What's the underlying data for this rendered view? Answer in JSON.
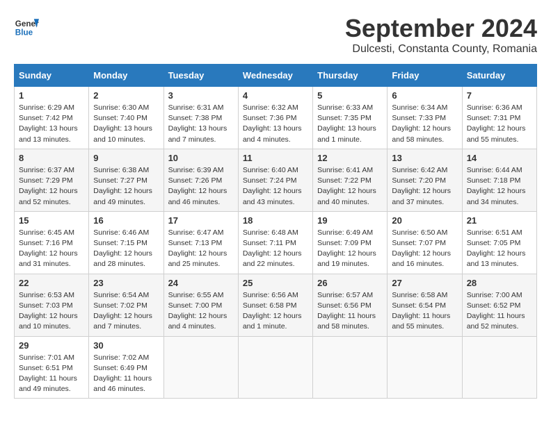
{
  "header": {
    "logo_line1": "General",
    "logo_line2": "Blue",
    "month_title": "September 2024",
    "location": "Dulcesti, Constanta County, Romania"
  },
  "weekdays": [
    "Sunday",
    "Monday",
    "Tuesday",
    "Wednesday",
    "Thursday",
    "Friday",
    "Saturday"
  ],
  "weeks": [
    [
      {
        "day": "1",
        "sunrise": "6:29 AM",
        "sunset": "7:42 PM",
        "daylight": "13 hours and 13 minutes."
      },
      {
        "day": "2",
        "sunrise": "6:30 AM",
        "sunset": "7:40 PM",
        "daylight": "13 hours and 10 minutes."
      },
      {
        "day": "3",
        "sunrise": "6:31 AM",
        "sunset": "7:38 PM",
        "daylight": "13 hours and 7 minutes."
      },
      {
        "day": "4",
        "sunrise": "6:32 AM",
        "sunset": "7:36 PM",
        "daylight": "13 hours and 4 minutes."
      },
      {
        "day": "5",
        "sunrise": "6:33 AM",
        "sunset": "7:35 PM",
        "daylight": "13 hours and 1 minute."
      },
      {
        "day": "6",
        "sunrise": "6:34 AM",
        "sunset": "7:33 PM",
        "daylight": "12 hours and 58 minutes."
      },
      {
        "day": "7",
        "sunrise": "6:36 AM",
        "sunset": "7:31 PM",
        "daylight": "12 hours and 55 minutes."
      }
    ],
    [
      {
        "day": "8",
        "sunrise": "6:37 AM",
        "sunset": "7:29 PM",
        "daylight": "12 hours and 52 minutes."
      },
      {
        "day": "9",
        "sunrise": "6:38 AM",
        "sunset": "7:27 PM",
        "daylight": "12 hours and 49 minutes."
      },
      {
        "day": "10",
        "sunrise": "6:39 AM",
        "sunset": "7:26 PM",
        "daylight": "12 hours and 46 minutes."
      },
      {
        "day": "11",
        "sunrise": "6:40 AM",
        "sunset": "7:24 PM",
        "daylight": "12 hours and 43 minutes."
      },
      {
        "day": "12",
        "sunrise": "6:41 AM",
        "sunset": "7:22 PM",
        "daylight": "12 hours and 40 minutes."
      },
      {
        "day": "13",
        "sunrise": "6:42 AM",
        "sunset": "7:20 PM",
        "daylight": "12 hours and 37 minutes."
      },
      {
        "day": "14",
        "sunrise": "6:44 AM",
        "sunset": "7:18 PM",
        "daylight": "12 hours and 34 minutes."
      }
    ],
    [
      {
        "day": "15",
        "sunrise": "6:45 AM",
        "sunset": "7:16 PM",
        "daylight": "12 hours and 31 minutes."
      },
      {
        "day": "16",
        "sunrise": "6:46 AM",
        "sunset": "7:15 PM",
        "daylight": "12 hours and 28 minutes."
      },
      {
        "day": "17",
        "sunrise": "6:47 AM",
        "sunset": "7:13 PM",
        "daylight": "12 hours and 25 minutes."
      },
      {
        "day": "18",
        "sunrise": "6:48 AM",
        "sunset": "7:11 PM",
        "daylight": "12 hours and 22 minutes."
      },
      {
        "day": "19",
        "sunrise": "6:49 AM",
        "sunset": "7:09 PM",
        "daylight": "12 hours and 19 minutes."
      },
      {
        "day": "20",
        "sunrise": "6:50 AM",
        "sunset": "7:07 PM",
        "daylight": "12 hours and 16 minutes."
      },
      {
        "day": "21",
        "sunrise": "6:51 AM",
        "sunset": "7:05 PM",
        "daylight": "12 hours and 13 minutes."
      }
    ],
    [
      {
        "day": "22",
        "sunrise": "6:53 AM",
        "sunset": "7:03 PM",
        "daylight": "12 hours and 10 minutes."
      },
      {
        "day": "23",
        "sunrise": "6:54 AM",
        "sunset": "7:02 PM",
        "daylight": "12 hours and 7 minutes."
      },
      {
        "day": "24",
        "sunrise": "6:55 AM",
        "sunset": "7:00 PM",
        "daylight": "12 hours and 4 minutes."
      },
      {
        "day": "25",
        "sunrise": "6:56 AM",
        "sunset": "6:58 PM",
        "daylight": "12 hours and 1 minute."
      },
      {
        "day": "26",
        "sunrise": "6:57 AM",
        "sunset": "6:56 PM",
        "daylight": "11 hours and 58 minutes."
      },
      {
        "day": "27",
        "sunrise": "6:58 AM",
        "sunset": "6:54 PM",
        "daylight": "11 hours and 55 minutes."
      },
      {
        "day": "28",
        "sunrise": "7:00 AM",
        "sunset": "6:52 PM",
        "daylight": "11 hours and 52 minutes."
      }
    ],
    [
      {
        "day": "29",
        "sunrise": "7:01 AM",
        "sunset": "6:51 PM",
        "daylight": "11 hours and 49 minutes."
      },
      {
        "day": "30",
        "sunrise": "7:02 AM",
        "sunset": "6:49 PM",
        "daylight": "11 hours and 46 minutes."
      },
      null,
      null,
      null,
      null,
      null
    ]
  ]
}
